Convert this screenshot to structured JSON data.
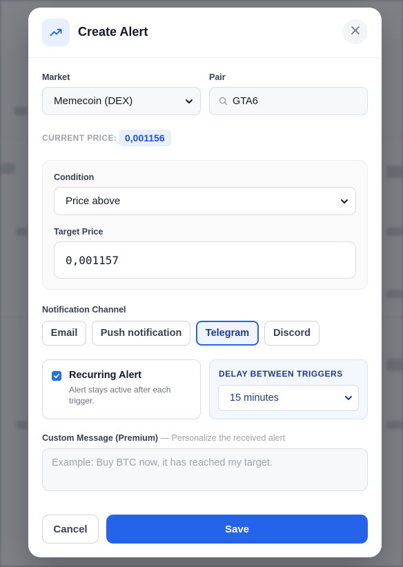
{
  "modal": {
    "title": "Create Alert",
    "icon": "trending-up-icon",
    "close_icon": "close-icon"
  },
  "market": {
    "label": "Market",
    "selected": "Memecoin (DEX)"
  },
  "pair": {
    "label": "Pair",
    "value": "GTA6",
    "icon": "search-icon"
  },
  "current_price": {
    "label": "CURRENT PRICE:",
    "value": "0,001156"
  },
  "condition": {
    "label": "Condition",
    "selected": "Price above"
  },
  "target_price": {
    "label": "Target Price",
    "value": "0,001157"
  },
  "notification": {
    "label": "Notification Channel",
    "channels": [
      {
        "label": "Email",
        "active": false
      },
      {
        "label": "Push notification",
        "active": false
      },
      {
        "label": "Telegram",
        "active": true
      },
      {
        "label": "Discord",
        "active": false
      }
    ]
  },
  "recurring": {
    "title": "Recurring Alert",
    "description": "Alert stays active after each trigger.",
    "checked": true
  },
  "delay": {
    "label": "DELAY BETWEEN TRIGGERS",
    "selected": "15 minutes"
  },
  "custom_message": {
    "label": "Custom Message (Premium)",
    "hint": "— Personalize the received alert",
    "placeholder": "Example: Buy BTC now, it has reached my target."
  },
  "actions": {
    "cancel": "Cancel",
    "save": "Save"
  },
  "colors": {
    "accent": "#2563eb",
    "accent_soft": "#e8f0fe",
    "text_dark": "#111827",
    "muted": "#9ca3af"
  }
}
